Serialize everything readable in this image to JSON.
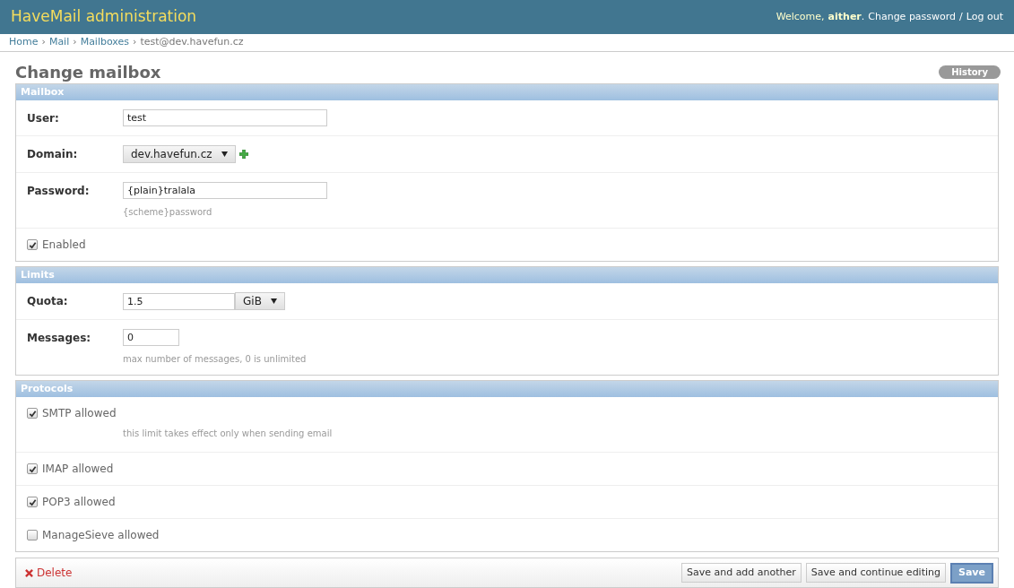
{
  "header": {
    "title": "HaveMail administration",
    "welcome": "Welcome,",
    "user": "aither",
    "period": ".",
    "links": [
      "Change password",
      "Log out"
    ],
    "separator": "/"
  },
  "breadcrumbs": {
    "separator": "›",
    "links": [
      "Home",
      "Mail",
      "Mailboxes"
    ],
    "current": "test@dev.havefun.cz"
  },
  "page_title": "Change mailbox",
  "history_button": "History",
  "sections": [
    {
      "title": "Mailbox",
      "rows": [
        {
          "kind": "text",
          "label": "User:",
          "value": "test"
        },
        {
          "kind": "select",
          "label": "Domain:",
          "value": "dev.havefun.cz"
        },
        {
          "kind": "text",
          "label": "Password:",
          "value": "{plain}tralala",
          "help": "{scheme}password"
        },
        {
          "kind": "checkbox",
          "label": "Enabled",
          "checked": true
        }
      ]
    },
    {
      "title": "Limits",
      "rows": [
        {
          "kind": "quota",
          "label": "Quota:",
          "value": "1.5",
          "unit": "GiB"
        },
        {
          "kind": "number",
          "label": "Messages:",
          "value": "0",
          "help": "max number of messages, 0 is unlimited"
        }
      ]
    },
    {
      "title": "Protocols",
      "rows": [
        {
          "kind": "checkbox",
          "label": "SMTP allowed",
          "checked": true,
          "help": "this limit takes effect only when sending email"
        },
        {
          "kind": "checkbox",
          "label": "IMAP allowed",
          "checked": true
        },
        {
          "kind": "checkbox",
          "label": "POP3 allowed",
          "checked": true
        },
        {
          "kind": "checkbox",
          "label": "ManageSieve allowed",
          "checked": false
        }
      ]
    }
  ],
  "submit_row": {
    "delete": "Delete",
    "buttons": [
      "Save and add another",
      "Save and continue editing",
      "Save"
    ]
  }
}
